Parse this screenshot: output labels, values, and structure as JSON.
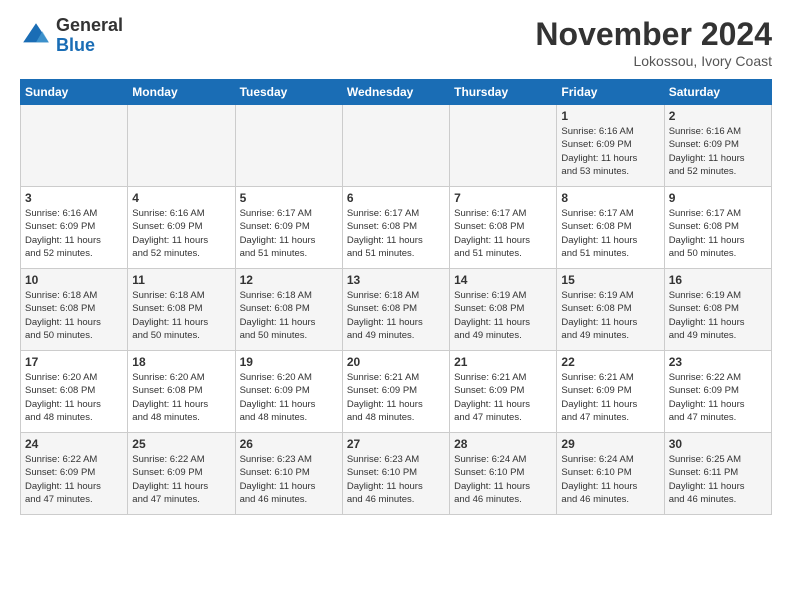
{
  "logo": {
    "general": "General",
    "blue": "Blue"
  },
  "header": {
    "month": "November 2024",
    "location": "Lokossou, Ivory Coast"
  },
  "weekdays": [
    "Sunday",
    "Monday",
    "Tuesday",
    "Wednesday",
    "Thursday",
    "Friday",
    "Saturday"
  ],
  "weeks": [
    [
      {
        "day": "",
        "info": ""
      },
      {
        "day": "",
        "info": ""
      },
      {
        "day": "",
        "info": ""
      },
      {
        "day": "",
        "info": ""
      },
      {
        "day": "",
        "info": ""
      },
      {
        "day": "1",
        "info": "Sunrise: 6:16 AM\nSunset: 6:09 PM\nDaylight: 11 hours\nand 53 minutes."
      },
      {
        "day": "2",
        "info": "Sunrise: 6:16 AM\nSunset: 6:09 PM\nDaylight: 11 hours\nand 52 minutes."
      }
    ],
    [
      {
        "day": "3",
        "info": "Sunrise: 6:16 AM\nSunset: 6:09 PM\nDaylight: 11 hours\nand 52 minutes."
      },
      {
        "day": "4",
        "info": "Sunrise: 6:16 AM\nSunset: 6:09 PM\nDaylight: 11 hours\nand 52 minutes."
      },
      {
        "day": "5",
        "info": "Sunrise: 6:17 AM\nSunset: 6:09 PM\nDaylight: 11 hours\nand 51 minutes."
      },
      {
        "day": "6",
        "info": "Sunrise: 6:17 AM\nSunset: 6:08 PM\nDaylight: 11 hours\nand 51 minutes."
      },
      {
        "day": "7",
        "info": "Sunrise: 6:17 AM\nSunset: 6:08 PM\nDaylight: 11 hours\nand 51 minutes."
      },
      {
        "day": "8",
        "info": "Sunrise: 6:17 AM\nSunset: 6:08 PM\nDaylight: 11 hours\nand 51 minutes."
      },
      {
        "day": "9",
        "info": "Sunrise: 6:17 AM\nSunset: 6:08 PM\nDaylight: 11 hours\nand 50 minutes."
      }
    ],
    [
      {
        "day": "10",
        "info": "Sunrise: 6:18 AM\nSunset: 6:08 PM\nDaylight: 11 hours\nand 50 minutes."
      },
      {
        "day": "11",
        "info": "Sunrise: 6:18 AM\nSunset: 6:08 PM\nDaylight: 11 hours\nand 50 minutes."
      },
      {
        "day": "12",
        "info": "Sunrise: 6:18 AM\nSunset: 6:08 PM\nDaylight: 11 hours\nand 50 minutes."
      },
      {
        "day": "13",
        "info": "Sunrise: 6:18 AM\nSunset: 6:08 PM\nDaylight: 11 hours\nand 49 minutes."
      },
      {
        "day": "14",
        "info": "Sunrise: 6:19 AM\nSunset: 6:08 PM\nDaylight: 11 hours\nand 49 minutes."
      },
      {
        "day": "15",
        "info": "Sunrise: 6:19 AM\nSunset: 6:08 PM\nDaylight: 11 hours\nand 49 minutes."
      },
      {
        "day": "16",
        "info": "Sunrise: 6:19 AM\nSunset: 6:08 PM\nDaylight: 11 hours\nand 49 minutes."
      }
    ],
    [
      {
        "day": "17",
        "info": "Sunrise: 6:20 AM\nSunset: 6:08 PM\nDaylight: 11 hours\nand 48 minutes."
      },
      {
        "day": "18",
        "info": "Sunrise: 6:20 AM\nSunset: 6:08 PM\nDaylight: 11 hours\nand 48 minutes."
      },
      {
        "day": "19",
        "info": "Sunrise: 6:20 AM\nSunset: 6:09 PM\nDaylight: 11 hours\nand 48 minutes."
      },
      {
        "day": "20",
        "info": "Sunrise: 6:21 AM\nSunset: 6:09 PM\nDaylight: 11 hours\nand 48 minutes."
      },
      {
        "day": "21",
        "info": "Sunrise: 6:21 AM\nSunset: 6:09 PM\nDaylight: 11 hours\nand 47 minutes."
      },
      {
        "day": "22",
        "info": "Sunrise: 6:21 AM\nSunset: 6:09 PM\nDaylight: 11 hours\nand 47 minutes."
      },
      {
        "day": "23",
        "info": "Sunrise: 6:22 AM\nSunset: 6:09 PM\nDaylight: 11 hours\nand 47 minutes."
      }
    ],
    [
      {
        "day": "24",
        "info": "Sunrise: 6:22 AM\nSunset: 6:09 PM\nDaylight: 11 hours\nand 47 minutes."
      },
      {
        "day": "25",
        "info": "Sunrise: 6:22 AM\nSunset: 6:09 PM\nDaylight: 11 hours\nand 47 minutes."
      },
      {
        "day": "26",
        "info": "Sunrise: 6:23 AM\nSunset: 6:10 PM\nDaylight: 11 hours\nand 46 minutes."
      },
      {
        "day": "27",
        "info": "Sunrise: 6:23 AM\nSunset: 6:10 PM\nDaylight: 11 hours\nand 46 minutes."
      },
      {
        "day": "28",
        "info": "Sunrise: 6:24 AM\nSunset: 6:10 PM\nDaylight: 11 hours\nand 46 minutes."
      },
      {
        "day": "29",
        "info": "Sunrise: 6:24 AM\nSunset: 6:10 PM\nDaylight: 11 hours\nand 46 minutes."
      },
      {
        "day": "30",
        "info": "Sunrise: 6:25 AM\nSunset: 6:11 PM\nDaylight: 11 hours\nand 46 minutes."
      }
    ]
  ]
}
